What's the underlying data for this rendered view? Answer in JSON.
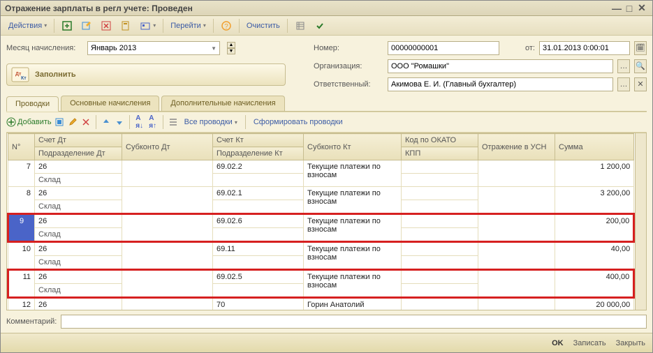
{
  "window": {
    "title": "Отражение зарплаты в регл учете: Проведен"
  },
  "toolbar": {
    "actions": "Действия",
    "go": "Перейти",
    "clear": "Очистить"
  },
  "header": {
    "month_label": "Месяц начисления:",
    "month_value": "Январь 2013",
    "number_label": "Номер:",
    "number_value": "00000000001",
    "from_label": "от:",
    "date_value": "31.01.2013  0:00:01",
    "org_label": "Организация:",
    "org_value": "ООО \"Ромашки\"",
    "resp_label": "Ответственный:",
    "resp_value": "Акимова Е. И. (Главный бухгалтер)"
  },
  "fill_button": "Заполнить",
  "tabs": {
    "t1": "Проводки",
    "t2": "Основные начисления",
    "t3": "Дополнительные начисления"
  },
  "subtoolbar": {
    "add": "Добавить",
    "all": "Все проводки",
    "form": "Сформировать проводки"
  },
  "columns": {
    "num": "N°",
    "schet_dt": "Счет Дт",
    "subconto_dt": "Субконто Дт",
    "schet_kt": "Счет Кт",
    "subconto_kt": "Субконто Кт",
    "okato": "Код по ОКАТО",
    "usn": "Отражение в УСН",
    "sum": "Сумма",
    "podr_dt": "Подразделение Дт",
    "podr_kt": "Подразделение Кт",
    "kpp": "КПП"
  },
  "rows": [
    {
      "n": "7",
      "sdt": "26",
      "podr": "Склад",
      "skt": "69.02.2",
      "subkt": "Текущие платежи по взносам",
      "sum": "1 200,00",
      "hl": false
    },
    {
      "n": "8",
      "sdt": "26",
      "podr": "Склад",
      "skt": "69.02.1",
      "subkt": "Текущие платежи по взносам",
      "sum": "3 200,00",
      "hl": false
    },
    {
      "n": "9",
      "sdt": "26",
      "podr": "Склад",
      "skt": "69.02.6",
      "subkt": "Текущие платежи по взносам",
      "sum": "200,00",
      "hl": true,
      "sel": true
    },
    {
      "n": "10",
      "sdt": "26",
      "podr": "Склад",
      "skt": "69.11",
      "subkt": "Текущие платежи по взносам",
      "sum": "40,00",
      "hl": false
    },
    {
      "n": "11",
      "sdt": "26",
      "podr": "Склад",
      "skt": "69.02.5",
      "subkt": "Текущие платежи по взносам",
      "sum": "400,00",
      "hl": true
    },
    {
      "n": "12",
      "sdt": "26",
      "podr": "",
      "skt": "70",
      "subkt": "Горин Анатолий Петрович",
      "sum": "20 000,00",
      "hl": false
    }
  ],
  "footer": {
    "comment_label": "Комментарий:",
    "ok": "OK",
    "save": "Записать",
    "close": "Закрыть"
  }
}
